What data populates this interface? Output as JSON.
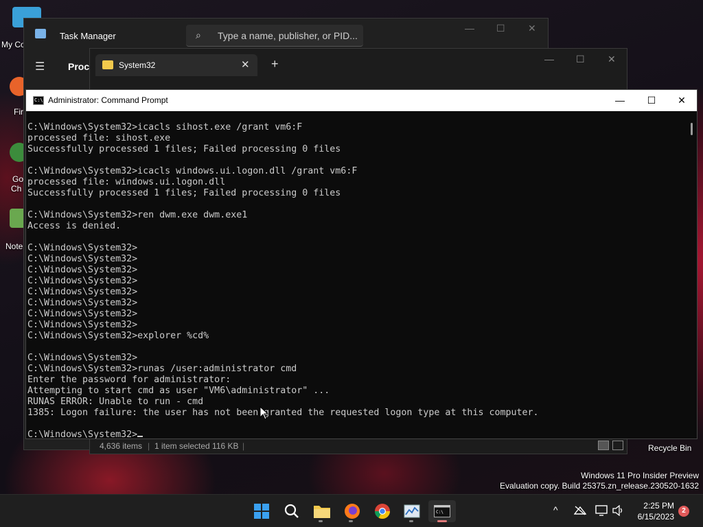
{
  "desktop": {
    "icons": [
      {
        "label": "My Co"
      },
      {
        "label": "Fir"
      },
      {
        "label": "Go"
      },
      {
        "label": "Ch"
      },
      {
        "label": "Note"
      }
    ],
    "recycle_bin_label": "Recycle Bin",
    "watermark": {
      "line1": "Windows 11 Pro Insider Preview",
      "line2": "Evaluation copy. Build 25375.zn_release.230520-1632"
    }
  },
  "task_manager": {
    "title": "Task Manager",
    "search_placeholder": "Type a name, publisher, or PID...",
    "nav_partial": "Proc",
    "controls": {
      "minimize": "—",
      "maximize": "☐",
      "close": "✕"
    }
  },
  "explorer": {
    "tab_title": "System32",
    "tab_close": "✕",
    "new_tab": "+",
    "status": {
      "items": "4,636 items",
      "selected": "1 item selected  116 KB"
    },
    "controls": {
      "minimize": "—",
      "maximize": "☐",
      "close": "✕"
    }
  },
  "cmd": {
    "title": "Administrator: Command Prompt",
    "controls": {
      "minimize": "—",
      "maximize": "☐",
      "close": "✕"
    },
    "lines": [
      "C:\\Windows\\System32>icacls sihost.exe /grant vm6:F",
      "processed file: sihost.exe",
      "Successfully processed 1 files; Failed processing 0 files",
      "",
      "C:\\Windows\\System32>icacls windows.ui.logon.dll /grant vm6:F",
      "processed file: windows.ui.logon.dll",
      "Successfully processed 1 files; Failed processing 0 files",
      "",
      "C:\\Windows\\System32>ren dwm.exe dwm.exe1",
      "Access is denied.",
      "",
      "C:\\Windows\\System32>",
      "C:\\Windows\\System32>",
      "C:\\Windows\\System32>",
      "C:\\Windows\\System32>",
      "C:\\Windows\\System32>",
      "C:\\Windows\\System32>",
      "C:\\Windows\\System32>",
      "C:\\Windows\\System32>",
      "C:\\Windows\\System32>explorer %cd%",
      "",
      "C:\\Windows\\System32>",
      "C:\\Windows\\System32>runas /user:administrator cmd",
      "Enter the password for administrator:",
      "Attempting to start cmd as user \"VM6\\administrator\" ...",
      "RUNAS ERROR: Unable to run - cmd",
      "1385: Logon failure: the user has not been granted the requested logon type at this computer.",
      "",
      "C:\\Windows\\System32>"
    ]
  },
  "taskbar": {
    "apps": [
      {
        "name": "start-icon"
      },
      {
        "name": "search-icon"
      },
      {
        "name": "file-explorer-icon"
      },
      {
        "name": "firefox-icon"
      },
      {
        "name": "chrome-icon"
      },
      {
        "name": "task-manager-icon"
      },
      {
        "name": "terminal-icon"
      }
    ],
    "clock": {
      "time": "2:25 PM",
      "date": "6/15/2023"
    },
    "notification_count": "2",
    "tray_chevron": "^"
  }
}
